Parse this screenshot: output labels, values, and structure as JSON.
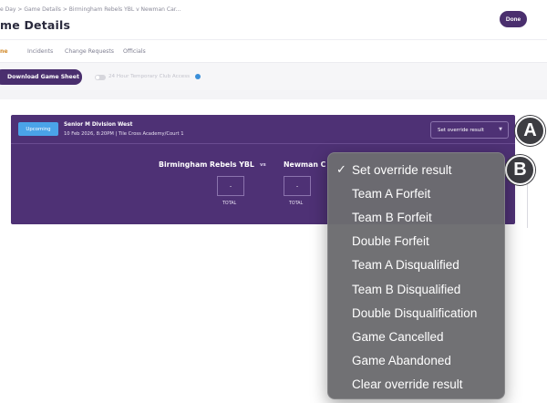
{
  "breadcrumb": {
    "item1": "e Day",
    "sep": ">",
    "item2": "Game Details",
    "item3": "Birmingham Rebels YBL v Newman Car..."
  },
  "header": {
    "title": "me Details",
    "done_label": "Done"
  },
  "tabs": [
    {
      "label": "ne",
      "active": true
    },
    {
      "label": "Incidents",
      "active": false
    },
    {
      "label": "Change Requests",
      "active": false
    },
    {
      "label": "Officials",
      "active": false
    }
  ],
  "toolbar": {
    "download_label": "Download Game Sheet",
    "toggle_label": "24 Hour Temporary Club Access"
  },
  "game": {
    "status": "Upcoming",
    "division": "Senior M Division West",
    "info": "10 Feb 2026, 8:20PM | Tile Cross Academy/Court 1",
    "override_select": "Set override result",
    "team_a": "Birmingham Rebels YBL",
    "vs": "vs",
    "team_b": "Newman C",
    "score_a": "-",
    "score_b": "-",
    "total_a": "TOTAL",
    "total_b": "TOTAL"
  },
  "callouts": {
    "a": "A",
    "b": "B"
  },
  "dropdown": {
    "check": "✓",
    "items": [
      "Set override result",
      "Team A Forfeit",
      "Team B Forfeit",
      "Double Forfeit",
      "Team A Disqualified",
      "Team B Disqualified",
      "Double Disqualification",
      "Game Cancelled",
      "Game Abandoned",
      "Clear override result"
    ],
    "selected_index": 0
  },
  "colors": {
    "brand_purple": "#4e3175",
    "button_purple": "#4a2f6e",
    "status_blue": "#4aa3e8",
    "active_tab": "#d28a2a",
    "menu_bg": "#6c6c70"
  }
}
